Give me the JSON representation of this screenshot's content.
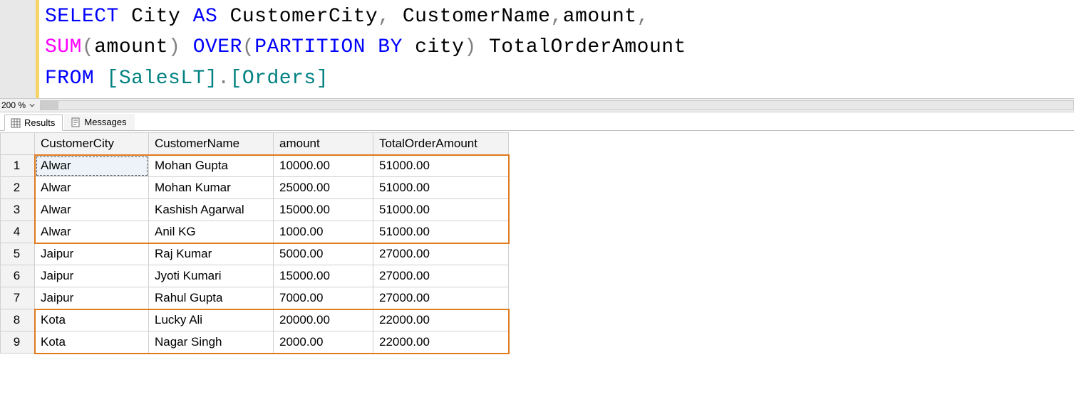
{
  "code": {
    "tokens": [
      [
        {
          "t": "SELECT",
          "c": "kw-blue"
        },
        {
          "t": " City ",
          "c": "plain"
        },
        {
          "t": "AS",
          "c": "kw-blue"
        },
        {
          "t": " CustomerCity",
          "c": "plain"
        },
        {
          "t": ",",
          "c": "kw-gray"
        },
        {
          "t": " CustomerName",
          "c": "plain"
        },
        {
          "t": ",",
          "c": "kw-gray"
        },
        {
          "t": "amount",
          "c": "plain"
        },
        {
          "t": ",",
          "c": "kw-gray"
        }
      ],
      [
        {
          "t": "SUM",
          "c": "kw-magenta"
        },
        {
          "t": "(",
          "c": "kw-gray"
        },
        {
          "t": "amount",
          "c": "plain"
        },
        {
          "t": ")",
          "c": "kw-gray"
        },
        {
          "t": " ",
          "c": "plain"
        },
        {
          "t": "OVER",
          "c": "kw-blue"
        },
        {
          "t": "(",
          "c": "kw-gray"
        },
        {
          "t": "PARTITION",
          "c": "kw-blue"
        },
        {
          "t": " ",
          "c": "plain"
        },
        {
          "t": "BY",
          "c": "kw-blue"
        },
        {
          "t": " city",
          "c": "plain"
        },
        {
          "t": ")",
          "c": "kw-gray"
        },
        {
          "t": " TotalOrderAmount",
          "c": "plain"
        }
      ],
      [
        {
          "t": "FROM",
          "c": "kw-blue"
        },
        {
          "t": " ",
          "c": "plain"
        },
        {
          "t": "[SalesLT]",
          "c": "kw-teal"
        },
        {
          "t": ".",
          "c": "kw-gray"
        },
        {
          "t": "[Orders]",
          "c": "kw-teal"
        }
      ]
    ]
  },
  "zoom": {
    "value": "200 %"
  },
  "tabs": {
    "results": "Results",
    "messages": "Messages"
  },
  "grid": {
    "headers": [
      "CustomerCity",
      "CustomerName",
      "amount",
      "TotalOrderAmount"
    ],
    "rows": [
      {
        "n": "1",
        "city": "Alwar",
        "name": "Mohan Gupta",
        "amount": "10000.00",
        "total": "51000.00"
      },
      {
        "n": "2",
        "city": "Alwar",
        "name": "Mohan Kumar",
        "amount": "25000.00",
        "total": "51000.00"
      },
      {
        "n": "3",
        "city": "Alwar",
        "name": "Kashish Agarwal",
        "amount": "15000.00",
        "total": "51000.00"
      },
      {
        "n": "4",
        "city": "Alwar",
        "name": "Anil KG",
        "amount": "1000.00",
        "total": "51000.00"
      },
      {
        "n": "5",
        "city": "Jaipur",
        "name": "Raj Kumar",
        "amount": "5000.00",
        "total": "27000.00"
      },
      {
        "n": "6",
        "city": "Jaipur",
        "name": "Jyoti Kumari",
        "amount": "15000.00",
        "total": "27000.00"
      },
      {
        "n": "7",
        "city": "Jaipur",
        "name": "Rahul Gupta",
        "amount": "7000.00",
        "total": "27000.00"
      },
      {
        "n": "8",
        "city": "Kota",
        "name": "Lucky Ali",
        "amount": "20000.00",
        "total": "22000.00"
      },
      {
        "n": "9",
        "city": "Kota",
        "name": "Nagar Singh",
        "amount": "2000.00",
        "total": "22000.00"
      }
    ],
    "highlightGroups": [
      {
        "from": 0,
        "to": 3
      },
      {
        "from": 7,
        "to": 8
      }
    ]
  }
}
